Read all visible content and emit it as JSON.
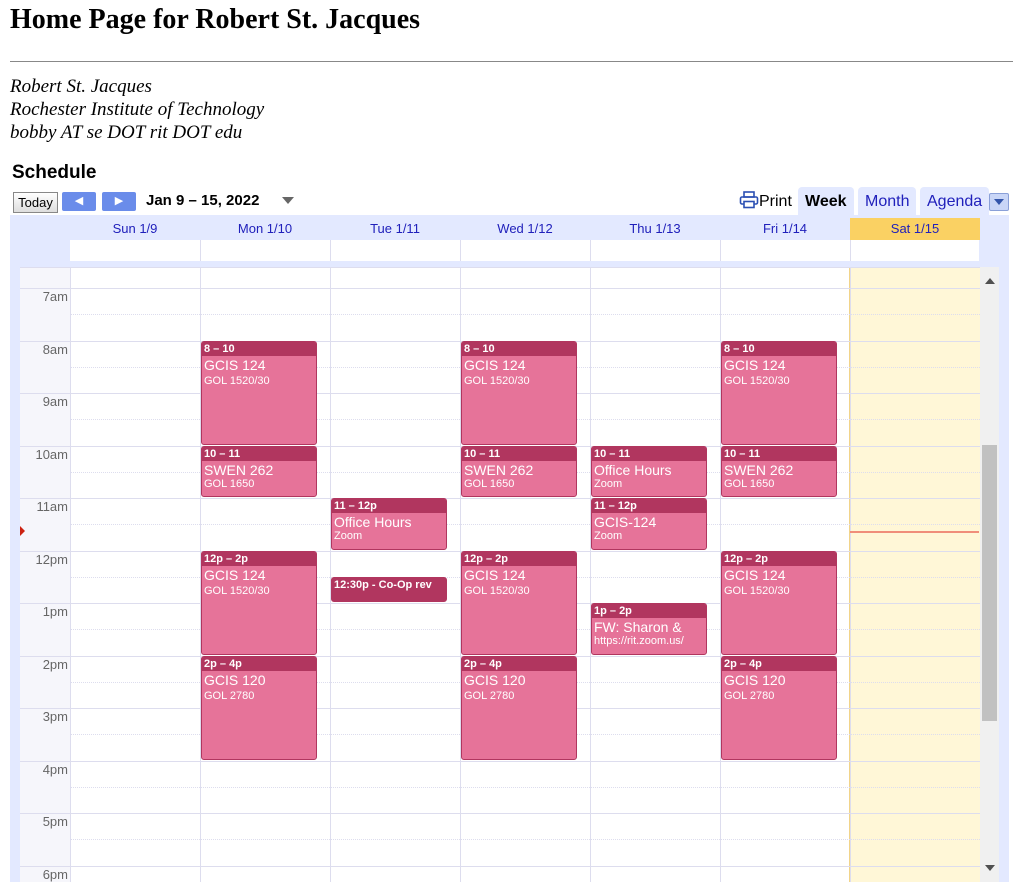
{
  "page": {
    "title": "Home Page for Robert St. Jacques",
    "contact": {
      "name": "Robert St. Jacques",
      "org": "Rochester Institute of Technology",
      "email": "bobby AT se DOT rit DOT edu"
    }
  },
  "schedule": {
    "heading": "Schedule",
    "today_label": "Today",
    "range_label": "Jan 9 – 15, 2022",
    "print_label": "Print",
    "views": {
      "week": "Week",
      "month": "Month",
      "agenda": "Agenda"
    },
    "active_view": "Week",
    "days": [
      "Sun 1/9",
      "Mon 1/10",
      "Tue 1/11",
      "Wed 1/12",
      "Thu 1/13",
      "Fri 1/14",
      "Sat 1/15"
    ],
    "today_day": "Sat 1/15",
    "hours": [
      "7am",
      "8am",
      "9am",
      "10am",
      "11am",
      "12pm",
      "1pm",
      "2pm",
      "3pm",
      "4pm",
      "5pm",
      "6pm"
    ],
    "colors": {
      "event": "#e67399",
      "event_header": "#b1365f",
      "today": "#fad163",
      "now_line": "#f08e7a"
    },
    "events": [
      {
        "day": 1,
        "start": 8,
        "end": 10,
        "time": "8 – 10",
        "title": "GCIS 124",
        "location": "GOL 1520/30"
      },
      {
        "day": 3,
        "start": 8,
        "end": 10,
        "time": "8 – 10",
        "title": "GCIS 124",
        "location": "GOL 1520/30"
      },
      {
        "day": 5,
        "start": 8,
        "end": 10,
        "time": "8 – 10",
        "title": "GCIS 124",
        "location": "GOL 1520/30"
      },
      {
        "day": 1,
        "start": 10,
        "end": 11,
        "time": "10 – 11",
        "title": "SWEN 262",
        "location": "GOL 1650"
      },
      {
        "day": 3,
        "start": 10,
        "end": 11,
        "time": "10 – 11",
        "title": "SWEN 262",
        "location": "GOL 1650"
      },
      {
        "day": 4,
        "start": 10,
        "end": 11,
        "time": "10 – 11",
        "title": "Office Hours",
        "location": "Zoom"
      },
      {
        "day": 5,
        "start": 10,
        "end": 11,
        "time": "10 – 11",
        "title": "SWEN 262",
        "location": "GOL 1650"
      },
      {
        "day": 2,
        "start": 11,
        "end": 12,
        "time": "11 – 12p",
        "title": "Office Hours",
        "location": "Zoom"
      },
      {
        "day": 4,
        "start": 11,
        "end": 12,
        "time": "11 – 12p",
        "title": "GCIS-124",
        "location": "Zoom"
      },
      {
        "day": 1,
        "start": 12,
        "end": 14,
        "time": "12p – 2p",
        "title": "GCIS 124",
        "location": "GOL 1520/30"
      },
      {
        "day": 3,
        "start": 12,
        "end": 14,
        "time": "12p – 2p",
        "title": "GCIS 124",
        "location": "GOL 1520/30"
      },
      {
        "day": 5,
        "start": 12,
        "end": 14,
        "time": "12p – 2p",
        "title": "GCIS 124",
        "location": "GOL 1520/30"
      },
      {
        "day": 2,
        "start": 12.5,
        "end": 13,
        "time": "12:30p - Co-Op rev",
        "title": "",
        "location": ""
      },
      {
        "day": 4,
        "start": 13,
        "end": 14,
        "time": "1p – 2p",
        "title": "FW: Sharon &",
        "location": "https://rit.zoom.us/"
      },
      {
        "day": 1,
        "start": 14,
        "end": 16,
        "time": "2p – 4p",
        "title": "GCIS 120",
        "location": "GOL 2780"
      },
      {
        "day": 3,
        "start": 14,
        "end": 16,
        "time": "2p – 4p",
        "title": "GCIS 120",
        "location": "GOL 2780"
      },
      {
        "day": 5,
        "start": 14,
        "end": 16,
        "time": "2p – 4p",
        "title": "GCIS 120",
        "location": "GOL 2780"
      }
    ]
  }
}
